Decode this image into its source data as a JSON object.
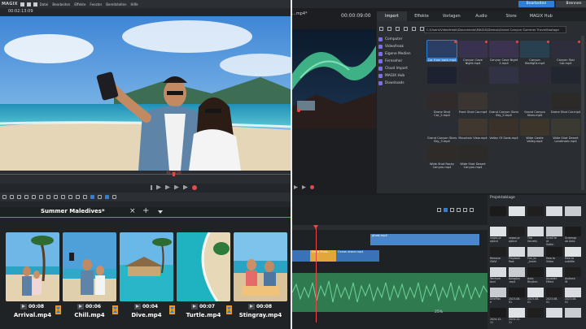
{
  "left": {
    "brand": "MAGIX",
    "menu": [
      "Datei",
      "Bearbeiten",
      "Effekte",
      "Fenster",
      "Bereitstellen",
      "Hilfe"
    ],
    "timecode": "00:02:13:09",
    "scrub_label": "Kz 24:20",
    "project_tab": "Summer Maledives*",
    "clips": [
      {
        "name": "Arrival.mp4",
        "duration": "00:08"
      },
      {
        "name": "Chill.mp4",
        "duration": "00:06"
      },
      {
        "name": "Dive.mp4",
        "duration": "00:04"
      },
      {
        "name": "Turtle.mp4",
        "duration": "00:07"
      },
      {
        "name": "Stingray.mp4",
        "duration": "00:08"
      }
    ]
  },
  "right": {
    "buttons": {
      "primary": "Bearbeiten",
      "secondary": "Brennen"
    },
    "preview_title": "...mp4*",
    "timecode": "00:00:09:00",
    "tabs": [
      "Import",
      "Effekte",
      "Vorlagen",
      "Audio",
      "Store",
      "MAGIX Hub"
    ],
    "path": "C:\\Users\\Videofreak\\Documents\\MAGIX\\Demos\\Grand Canyon Summer Travel\\footage",
    "sources": [
      "Computer",
      "Videofreak",
      "Eigene Medien",
      "Fernseher",
      "Cloud Import",
      "MAGIX Hub",
      "Downloads"
    ],
    "media": [
      "Car from back.mp4",
      "Canyon Cave Night.mp4",
      "Canyon Cave Night 2.mp4",
      "Canyon Starlight.mp4",
      "Canyon Star Car.mp4",
      "",
      "",
      "",
      "",
      "",
      "Drone Shot Car_2.mp4",
      "Front Shot Car.mp4",
      "Grand Canyon Stars Sky_2.mp4",
      "Grand Canyon Stars.mp4",
      "Drone Shot Car.mp4",
      "Grand Canyon Stars Sky_3.mp4",
      "Mountain View.mp4",
      "Valley Of Gods.mp4",
      "Wide Castle Valley.mp4",
      "Wide Shot Desert Landmark.mp4",
      "Wide Shot Rocky Canyon.mp4",
      "Wide Shot Desert Canyon.mp4"
    ],
    "timeline_clips": {
      "a": "ghost.mp4",
      "b": "Drive Front...",
      "c": "Ocean drone.mp4"
    },
    "zoom": "25%",
    "bin_title": "Projektablage",
    "bin": [
      "",
      "",
      "",
      "",
      "",
      "vegas pr\nojecut",
      "vegas pr\nojecut",
      "The\nSecrets",
      "Scroll te\nxt\nSettin",
      "Screengr\nab Auto",
      "Remove\nOldVi",
      "Playback\nflaw",
      "Fun_vs\n_Anom",
      "How to\nVideo",
      "How to\nsubtitle",
      "Teichum\nAnni",
      "Autoplay\n.mp4",
      "Auto\nRhythm",
      "Auswahl\nEffect",
      "Audiosh\nift",
      "ArtePlac\ne",
      "2023-08-\n01",
      "2023-08-\n01",
      "2023-08-\n01",
      "2023-08-\n01",
      "2024-12-\n11",
      "2024-12-\n11",
      "",
      "",
      ""
    ]
  }
}
